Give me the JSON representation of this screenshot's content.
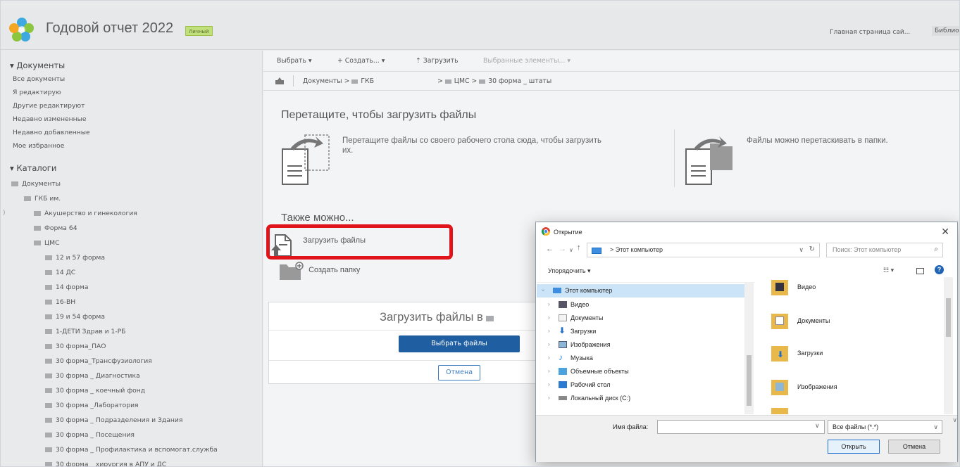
{
  "header": {
    "site_title": "Годовой отчет 2022",
    "badge": "Личный",
    "home_link": "Главная страница сай...",
    "library_link": "Библио"
  },
  "sidebar": {
    "documents_heading": "▾ Документы",
    "document_views": [
      "Все документы",
      "Я редактирую",
      "Другие редактируют",
      "Недавно измененные",
      "Недавно добавленные",
      "Мое избранное"
    ],
    "catalogs_heading": "▾ Каталоги",
    "tree": [
      {
        "label": "Документы",
        "level": 0
      },
      {
        "label": "ГКБ им.",
        "level": 1
      },
      {
        "label": "Акушерство и гинекология",
        "level": 2
      },
      {
        "label": "Форма 64",
        "level": 2
      },
      {
        "label": "ЦМС",
        "level": 2
      },
      {
        "label": "12 и 57 форма",
        "level": 3
      },
      {
        "label": "14 ДС",
        "level": 3
      },
      {
        "label": "14 форма",
        "level": 3
      },
      {
        "label": "16-ВН",
        "level": 3
      },
      {
        "label": "19 и 54 форма",
        "level": 3
      },
      {
        "label": "1-ДЕТИ Здрав и 1-РБ",
        "level": 3
      },
      {
        "label": "30 форма_ПАО",
        "level": 3
      },
      {
        "label": "30 форма_Трансфузиология",
        "level": 3
      },
      {
        "label": "30 форма _ Диагностика",
        "level": 3
      },
      {
        "label": "30 форма _ коечный фонд",
        "level": 3
      },
      {
        "label": "30 форма _Лаборатория",
        "level": 3
      },
      {
        "label": "30 форма _ Подразделения и Здания",
        "level": 3
      },
      {
        "label": "30 форма _ Посещения",
        "level": 3
      },
      {
        "label": "30 форма _ Профилактика и вспомогат.служба",
        "level": 3
      },
      {
        "label": "30 форма _ хирургия в АПУ и ДС",
        "level": 3
      }
    ]
  },
  "toolbar": {
    "select": "Выбрать ▾",
    "create": "+ Создать... ▾",
    "upload": "⇡ Загрузить",
    "selected": "Выбранные элементы... ▾"
  },
  "breadcrumb": {
    "part1": "Документы >",
    "part2": "ГКБ",
    "part3": "> ",
    "part4": "ЦМС >",
    "part5": "30 форма _ штаты"
  },
  "dropzone": {
    "title": "Перетащите, чтобы загрузить файлы",
    "text_left": "Перетащите файлы со своего рабочего стола сюда, чтобы загрузить их.",
    "text_right": "Файлы можно перетаскивать в папки.",
    "also_heading": "Также можно...",
    "upload_files": "Загрузить файлы",
    "create_folder": "Создать папку"
  },
  "upload_panel": {
    "title": "Загрузить файлы в",
    "choose_files": "Выбрать файлы",
    "cancel": "Отмена"
  },
  "dialog": {
    "title": "Открытие",
    "address": "> Этот компьютер",
    "search_placeholder": "Поиск: Этот компьютер",
    "organize": "Упорядочить ▾",
    "tree": [
      {
        "label": "Этот компьютер",
        "selected": true,
        "expanded": true
      },
      {
        "label": "Видео"
      },
      {
        "label": "Документы"
      },
      {
        "label": "Загрузки"
      },
      {
        "label": "Изображения"
      },
      {
        "label": "Музыка"
      },
      {
        "label": "Объемные объекты"
      },
      {
        "label": "Рабочий стол"
      },
      {
        "label": "Локальный диск (C:)"
      }
    ],
    "files": [
      "Видео",
      "Документы",
      "Загрузки",
      "Изображения"
    ],
    "filename_label": "Имя файла:",
    "filename_value": "",
    "filetype": "Все файлы (*.*)",
    "open_button": "Открыть",
    "cancel_button": "Отмена"
  },
  "colors": {
    "highlight": "#e0151c",
    "primary_button": "#1f5ea0",
    "selection": "#cce4f7"
  }
}
